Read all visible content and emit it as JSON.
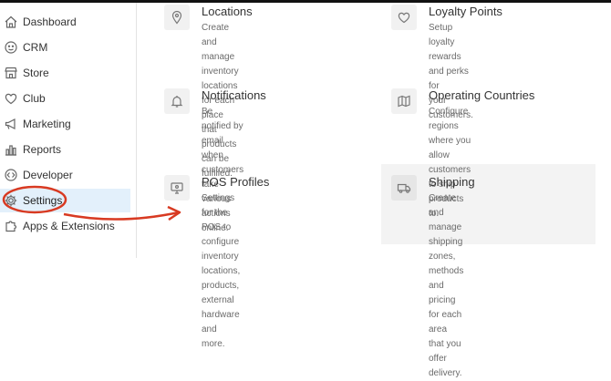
{
  "sidebar": {
    "items": [
      {
        "label": "Dashboard",
        "icon": "house-icon"
      },
      {
        "label": "CRM",
        "icon": "smiley-icon"
      },
      {
        "label": "Store",
        "icon": "storefront-icon"
      },
      {
        "label": "Club",
        "icon": "heart-icon"
      },
      {
        "label": "Marketing",
        "icon": "megaphone-icon"
      },
      {
        "label": "Reports",
        "icon": "bar-chart-icon"
      },
      {
        "label": "Developer",
        "icon": "code-icon"
      },
      {
        "label": "Settings",
        "icon": "gear-icon",
        "active": true
      },
      {
        "label": "Apps & Extensions",
        "icon": "puzzle-icon"
      }
    ]
  },
  "cards": {
    "locations": {
      "title": "Locations",
      "desc1": "Create and manage inventory",
      "desc2": "locations for each place that products",
      "desc3": "can be fulfilled.",
      "icon": "map-pin-icon"
    },
    "loyalty": {
      "title": "Loyalty Points",
      "desc1": "Setup loyalty rewards and perks for",
      "desc2": "your customers.",
      "icon": "heart-icon"
    },
    "notifications": {
      "title": "Notifications",
      "desc1": "Be notified by email when customers",
      "desc2": "take various actions online.",
      "icon": "bell-icon"
    },
    "countries": {
      "title": "Operating Countries",
      "desc1": "Configure regions where you allow",
      "desc2": "customers to ship products to.",
      "icon": "folded-map-icon"
    },
    "pos": {
      "title": "POS Profiles",
      "desc1": "Settings for the POS to configure",
      "desc2": "inventory locations, products, external",
      "desc3": "hardware and more.",
      "icon": "monitor-icon"
    },
    "shipping": {
      "title": "Shipping",
      "desc1": "Create and manage shipping zones,",
      "desc2": "methods and pricing for each area",
      "desc3": "that you offer delivery.",
      "icon": "truck-icon"
    }
  },
  "colors": {
    "annotation": "#d83a22",
    "active_bg": "#e3f0fb",
    "icon_tile": "#f1f1f1",
    "shipping_bg": "#f3f3f3"
  }
}
